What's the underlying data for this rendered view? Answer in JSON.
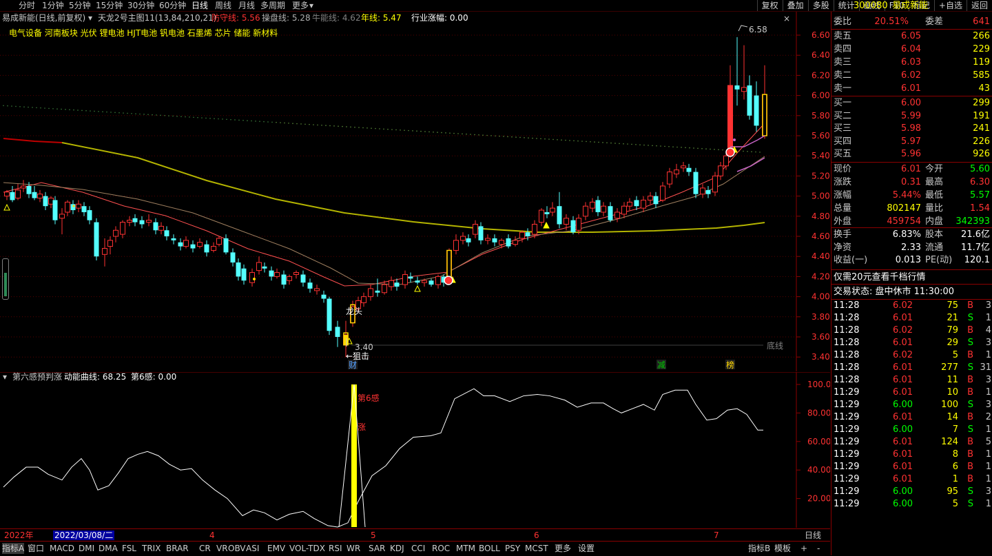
{
  "topbar": {
    "tabs": [
      "分时",
      "1分钟",
      "5分钟",
      "15分钟",
      "30分钟",
      "60分钟",
      "日线",
      "周线",
      "月线",
      "多周期",
      "更多"
    ],
    "active_tab": "日线",
    "right_buttons": [
      "复权",
      "叠加",
      "多股",
      "统计",
      "画线",
      "F10",
      "标记",
      "+自选",
      "返回"
    ]
  },
  "main_chart": {
    "stock_title": "易成新能(日线,前复权)",
    "indicator_prefix": "天龙2号主图11(13,84,210,21)",
    "fangshou": "防守线: 5.56",
    "caopan": "操盘线: 5.28",
    "niuneng": "牛能线: 4.62",
    "nianxian": "年线: 5.47",
    "hangye": "行业涨幅: 0.00",
    "concepts": "电气设备 河南板块 光伏 锂电池 HJT电池 钒电池 石墨烯 芯片 储能 新材料",
    "y_ticks": [
      "6.60",
      "6.40",
      "6.20",
      "6.00",
      "5.80",
      "5.60",
      "5.40",
      "5.20",
      "5.00",
      "4.80",
      "4.60",
      "4.40",
      "4.20",
      "4.00",
      "3.80",
      "3.60",
      "3.40"
    ],
    "high_mark": "6.58",
    "low_mark": "3.40",
    "longtou": "龙头",
    "jiji": "←狙击",
    "dixian": "底线",
    "badges": [
      "财",
      "减",
      "榜"
    ]
  },
  "ind_chart": {
    "title": "第六感预判涨",
    "energy": "动能曲线: 68.25",
    "sixth": "第6感: 0.00",
    "y_ticks": [
      "100.0",
      "80.00",
      "60.00",
      "40.00",
      "20.00"
    ],
    "signal_label": "第6感",
    "zhang": "涨"
  },
  "timeline": {
    "year": "2022年",
    "date_box": "2022/03/08/二",
    "months": [
      "4",
      "5",
      "6",
      "7"
    ],
    "period": "日线"
  },
  "bottom_tabs": [
    "指标A",
    "窗口",
    "MACD",
    "DMI",
    "DMA",
    "FSL",
    "TRIX",
    "BRAR",
    "CR",
    "VR",
    "OBV",
    "ASI",
    "EMV",
    "VOL-TDX",
    "RSI",
    "WR",
    "SAR",
    "KDJ",
    "CCI",
    "ROC",
    "MTM",
    "BOLL",
    "PSY",
    "MCST",
    "更多",
    "设置"
  ],
  "bottom_right": [
    "指标B",
    "模板",
    "+",
    "-"
  ],
  "colors": {
    "up": "#ff3232",
    "down": "#54ffff",
    "yellow": "#ffff00",
    "ma_yellow": "#c8c800",
    "grid": "#5a0000"
  },
  "quote": {
    "code": "300080",
    "name": "易成新能",
    "weibi_label": "委比",
    "weibi": "20.51%",
    "weicha_label": "委差",
    "weicha": "641",
    "sells": [
      {
        "label": "卖五",
        "price": "6.05",
        "vol": "266"
      },
      {
        "label": "卖四",
        "price": "6.04",
        "vol": "229"
      },
      {
        "label": "卖三",
        "price": "6.03",
        "vol": "119"
      },
      {
        "label": "卖二",
        "price": "6.02",
        "vol": "585"
      },
      {
        "label": "卖一",
        "price": "6.01",
        "vol": "43"
      }
    ],
    "buys": [
      {
        "label": "买一",
        "price": "6.00",
        "vol": "299"
      },
      {
        "label": "买二",
        "price": "5.99",
        "vol": "191"
      },
      {
        "label": "买三",
        "price": "5.98",
        "vol": "241"
      },
      {
        "label": "买四",
        "price": "5.97",
        "vol": "226"
      },
      {
        "label": "买五",
        "price": "5.96",
        "vol": "926"
      }
    ],
    "stats": [
      {
        "l1": "现价",
        "v1": "6.01",
        "c1": "#ff3232",
        "l2": "今开",
        "v2": "5.60",
        "c2": "#00ff00"
      },
      {
        "l1": "涨跌",
        "v1": "0.31",
        "c1": "#ff3232",
        "l2": "最高",
        "v2": "6.30",
        "c2": "#ff3232"
      },
      {
        "l1": "涨幅",
        "v1": "5.44%",
        "c1": "#ff3232",
        "l2": "最低",
        "v2": "5.57",
        "c2": "#00ff00"
      },
      {
        "l1": "总量",
        "v1": "802147",
        "c1": "#ffff00",
        "l2": "量比",
        "v2": "1.54",
        "c2": "#ff3232"
      },
      {
        "l1": "外盘",
        "v1": "459754",
        "c1": "#ff3232",
        "l2": "内盘",
        "v2": "342393",
        "c2": "#00ff00"
      }
    ],
    "stats2": [
      {
        "l1": "换手",
        "v1": "6.83%",
        "l2": "股本",
        "v2": "21.6亿"
      },
      {
        "l1": "净资",
        "v1": "2.33",
        "l2": "流通",
        "v2": "11.7亿"
      },
      {
        "l1": "收益(一)",
        "v1": "0.013",
        "l2": "PE(动)",
        "v2": "120.1"
      }
    ],
    "promo": "仅需20元查看千档行情",
    "trade_status": "交易状态: 盘中休市 11:30:00",
    "ticks": [
      [
        "11:28",
        "6.02",
        "75",
        "B",
        "3"
      ],
      [
        "11:28",
        "6.01",
        "21",
        "S",
        "1"
      ],
      [
        "11:28",
        "6.02",
        "79",
        "B",
        "4"
      ],
      [
        "11:28",
        "6.01",
        "29",
        "S",
        "3"
      ],
      [
        "11:28",
        "6.02",
        "5",
        "B",
        "1"
      ],
      [
        "11:28",
        "6.01",
        "277",
        "S",
        "31"
      ],
      [
        "11:28",
        "6.01",
        "11",
        "B",
        "3"
      ],
      [
        "11:29",
        "6.01",
        "10",
        "B",
        "1"
      ],
      [
        "11:29",
        "6.00",
        "100",
        "S",
        "3"
      ],
      [
        "11:29",
        "6.01",
        "14",
        "B",
        "2"
      ],
      [
        "11:29",
        "6.00",
        "7",
        "S",
        "1"
      ],
      [
        "11:29",
        "6.01",
        "124",
        "B",
        "5"
      ],
      [
        "11:29",
        "6.01",
        "8",
        "B",
        "1"
      ],
      [
        "11:29",
        "6.01",
        "6",
        "B",
        "1"
      ],
      [
        "11:29",
        "6.01",
        "1",
        "B",
        "1"
      ],
      [
        "11:29",
        "6.00",
        "95",
        "S",
        "3"
      ],
      [
        "11:29",
        "6.00",
        "5",
        "S",
        "1"
      ]
    ]
  }
}
